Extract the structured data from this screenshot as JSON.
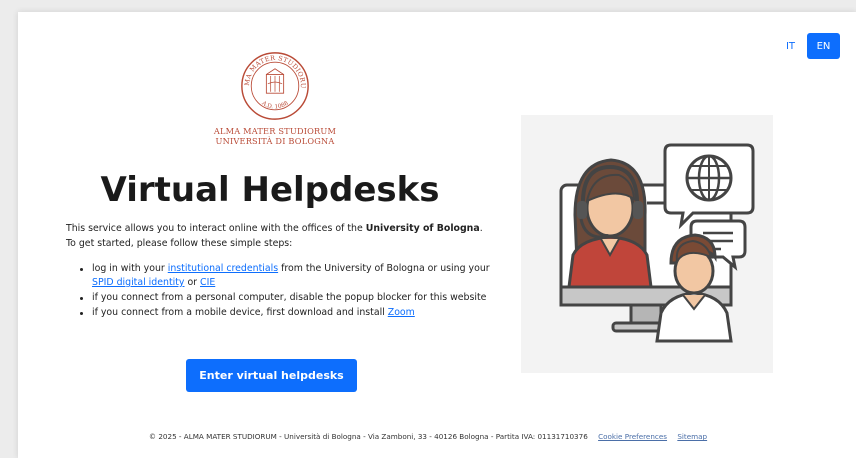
{
  "lang": {
    "it_label": "IT",
    "en_label": "EN",
    "active": "EN",
    "accent": "#0d6efd"
  },
  "logo": {
    "seal_lines": [
      "ALMA MATER STUDIORUM",
      "A.D. 1088"
    ],
    "line1": "ALMA MATER STUDIORUM",
    "line2": "UNIVERSITÀ DI BOLOGNA",
    "color": "#b94a36"
  },
  "title": "Virtual Helpdesks",
  "intro": {
    "before": "This service allows you to interact online with the offices of the ",
    "bold": "University of Bologna",
    "after": ". To get started, please follow these simple steps:"
  },
  "steps": {
    "s1_a": "log in with your ",
    "s1_link1": "institutional credentials",
    "s1_b": " from the University of Bologna or using your ",
    "s1_link2": "SPID digital identity",
    "s1_c": " or ",
    "s1_link3": "CIE",
    "s2": "if you connect from a personal computer, disable the popup blocker for this website",
    "s3_a": "if you connect from a mobile device, first download and install ",
    "s3_link": "Zoom"
  },
  "enter_button": "Enter virtual helpdesks",
  "illustration": {
    "icon": "helpdesk-agent-illustration",
    "globe_icon": "globe-icon",
    "chat_icon": "chat-bubble-icon"
  },
  "footer": {
    "text": "© 2025 - ALMA MATER STUDIORUM - Università di Bologna - Via Zamboni, 33 - 40126 Bologna - Partita IVA: 01131710376",
    "cookie_link": "Cookie Preferences",
    "sitemap_link": "Sitemap"
  }
}
